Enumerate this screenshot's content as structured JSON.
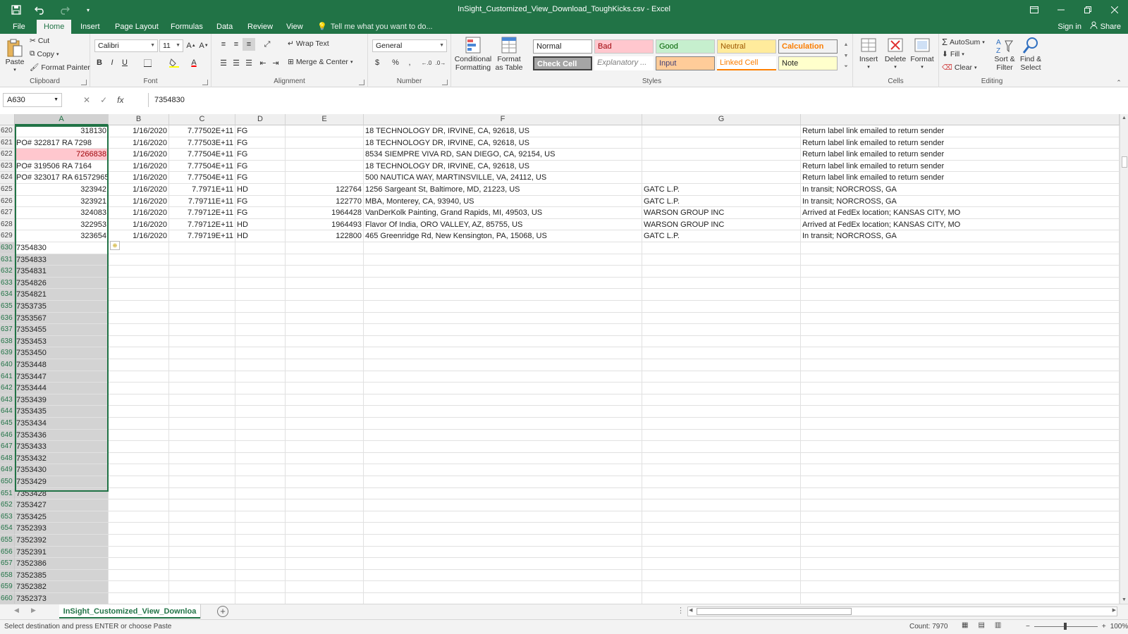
{
  "window": {
    "title": "InSight_Customized_View_Download_ToughKicks.csv - Excel"
  },
  "tabs": [
    "File",
    "Home",
    "Insert",
    "Page Layout",
    "Formulas",
    "Data",
    "Review",
    "View"
  ],
  "tellme": "Tell me what you want to do...",
  "signin": "Sign in",
  "share": "Share",
  "ribbon": {
    "clipboard": {
      "label": "Clipboard",
      "paste": "Paste",
      "cut": "Cut",
      "copy": "Copy",
      "format_painter": "Format Painter"
    },
    "font": {
      "label": "Font",
      "name": "Calibri",
      "size": "11"
    },
    "alignment": {
      "label": "Alignment",
      "wrap": "Wrap Text",
      "merge": "Merge & Center"
    },
    "number": {
      "label": "Number",
      "format": "General"
    },
    "styles": {
      "label": "Styles",
      "conditional": "Conditional Formatting",
      "format_table": "Format as Table",
      "normal": "Normal",
      "bad": "Bad",
      "good": "Good",
      "neutral": "Neutral",
      "calculation": "Calculation",
      "check": "Check Cell",
      "explanatory": "Explanatory ...",
      "input": "Input",
      "linked": "Linked Cell",
      "note": "Note"
    },
    "cells": {
      "label": "Cells",
      "insert": "Insert",
      "delete": "Delete",
      "format": "Format"
    },
    "editing": {
      "label": "Editing",
      "autosum": "AutoSum",
      "fill": "Fill",
      "clear": "Clear",
      "sort": "Sort & Filter",
      "find": "Find & Select"
    }
  },
  "formula_bar": {
    "namebox": "A630",
    "value": "7354830"
  },
  "columns": [
    "A",
    "B",
    "C",
    "D",
    "E",
    "F",
    "G"
  ],
  "rows": [
    {
      "n": "620",
      "a": "318130",
      "b": "1/16/2020",
      "c": "7.77502E+11",
      "d": "FG",
      "e": "",
      "f": "18 TECHNOLOGY DR, IRVINE, CA, 92618, US",
      "g": "",
      "h": "Return label link emailed to return sender"
    },
    {
      "n": "621",
      "a": "PO# 322817 RA 7298",
      "b": "1/16/2020",
      "c": "7.77503E+11",
      "d": "FG",
      "e": "",
      "f": "18 TECHNOLOGY DR, IRVINE, CA, 92618, US",
      "g": "",
      "h": "Return label link emailed to return sender"
    },
    {
      "n": "622",
      "a": "7266838",
      "b": "1/16/2020",
      "c": "7.77504E+11",
      "d": "FG",
      "e": "",
      "f": "8534 SIEMPRE VIVA RD, SAN DIEGO, CA, 92154, US",
      "g": "",
      "h": "Return label link emailed to return sender"
    },
    {
      "n": "623",
      "a": "PO# 319506 RA 7164",
      "b": "1/16/2020",
      "c": "7.77504E+11",
      "d": "FG",
      "e": "",
      "f": "18 TECHNOLOGY DR, IRVINE, CA, 92618, US",
      "g": "",
      "h": "Return label link emailed to return sender"
    },
    {
      "n": "624",
      "a": "PO# 323017 RA 61572965",
      "b": "1/16/2020",
      "c": "7.77504E+11",
      "d": "FG",
      "e": "",
      "f": "500 NAUTICA WAY, MARTINSVILLE, VA, 24112, US",
      "g": "",
      "h": "Return label link emailed to return sender"
    },
    {
      "n": "625",
      "a": "323942",
      "b": "1/16/2020",
      "c": "7.7971E+11",
      "d": "HD",
      "e": "122764",
      "f": "1256 Sargeant St, Baltimore, MD, 21223, US",
      "g": "GATC L.P.",
      "h": "In transit; NORCROSS, GA"
    },
    {
      "n": "626",
      "a": "323921",
      "b": "1/16/2020",
      "c": "7.79711E+11",
      "d": "FG",
      "e": "122770",
      "f": "MBA, Monterey, CA, 93940, US",
      "g": "GATC L.P.",
      "h": "In transit; NORCROSS, GA"
    },
    {
      "n": "627",
      "a": "324083",
      "b": "1/16/2020",
      "c": "7.79712E+11",
      "d": "FG",
      "e": "1964428",
      "f": "VanDerKolk Painting, Grand Rapids, MI, 49503, US",
      "g": "WARSON GROUP INC",
      "h": "Arrived at FedEx location; KANSAS CITY, MO"
    },
    {
      "n": "628",
      "a": "322953",
      "b": "1/16/2020",
      "c": "7.79712E+11",
      "d": "HD",
      "e": "1964493",
      "f": "Flavor Of India, ORO VALLEY, AZ, 85755, US",
      "g": "WARSON GROUP INC",
      "h": "Arrived at FedEx location; KANSAS CITY, MO"
    },
    {
      "n": "629",
      "a": "323654",
      "b": "1/16/2020",
      "c": "7.79719E+11",
      "d": "HD",
      "e": "122800",
      "f": "465 Greenridge Rd, New Kensington, PA, 15068, US",
      "g": "GATC L.P.",
      "h": "In transit; NORCROSS, GA"
    }
  ],
  "pasted_rows": [
    {
      "n": "630",
      "a": "7354830"
    },
    {
      "n": "631",
      "a": "7354833"
    },
    {
      "n": "632",
      "a": "7354831"
    },
    {
      "n": "633",
      "a": "7354826"
    },
    {
      "n": "634",
      "a": "7354821"
    },
    {
      "n": "635",
      "a": "7353735"
    },
    {
      "n": "636",
      "a": "7353567"
    },
    {
      "n": "637",
      "a": "7353455"
    },
    {
      "n": "638",
      "a": "7353453"
    },
    {
      "n": "639",
      "a": "7353450"
    },
    {
      "n": "640",
      "a": "7353448"
    },
    {
      "n": "641",
      "a": "7353447"
    },
    {
      "n": "642",
      "a": "7353444"
    },
    {
      "n": "643",
      "a": "7353439"
    },
    {
      "n": "644",
      "a": "7353435"
    },
    {
      "n": "645",
      "a": "7353434"
    },
    {
      "n": "646",
      "a": "7353436"
    },
    {
      "n": "647",
      "a": "7353433"
    },
    {
      "n": "648",
      "a": "7353432"
    },
    {
      "n": "649",
      "a": "7353430"
    },
    {
      "n": "650",
      "a": "7353429"
    },
    {
      "n": "651",
      "a": "7353428"
    },
    {
      "n": "652",
      "a": "7353427"
    },
    {
      "n": "653",
      "a": "7353425"
    },
    {
      "n": "654",
      "a": "7352393"
    },
    {
      "n": "655",
      "a": "7352392"
    },
    {
      "n": "656",
      "a": "7352391"
    },
    {
      "n": "657",
      "a": "7352386"
    },
    {
      "n": "658",
      "a": "7352385"
    },
    {
      "n": "659",
      "a": "7352382"
    },
    {
      "n": "660",
      "a": "7352373"
    }
  ],
  "sheet_tab": "InSight_Customized_View_Downloa",
  "status": {
    "message": "Select destination and press ENTER or choose Paste",
    "count": "Count: 7970",
    "zoom": "100%"
  },
  "colors": {
    "excel_green": "#217346",
    "bad_fill": "#ffc7ce",
    "bad_text": "#9c0006",
    "selection_fill": "#d3d3d3"
  }
}
